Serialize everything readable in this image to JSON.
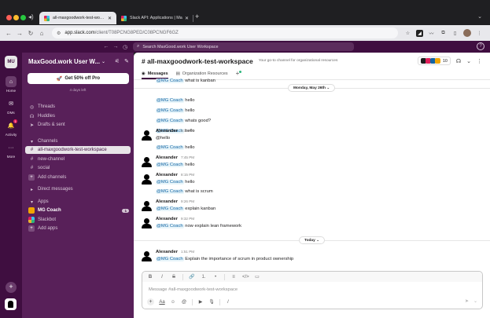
{
  "browser": {
    "tabs": [
      {
        "label": "all-maxgoodwork-test-works",
        "active": true
      },
      {
        "label": "Slack API: Applications | Ma",
        "active": false
      }
    ],
    "url_host": "app.slack.com",
    "url_path": "/client/T08PCNG8PED/C08PCNGF6GZ",
    "new_tab": "+"
  },
  "slack_top": {
    "search_placeholder": "Search MaxGood.work User Workspace",
    "help": "?"
  },
  "rail": {
    "workspace_initials": "MU",
    "items": [
      {
        "label": "Home",
        "icon": "home-icon",
        "glyph": "⌂"
      },
      {
        "label": "DMs",
        "icon": "dm-icon",
        "glyph": "✉"
      },
      {
        "label": "Activity",
        "icon": "bell-icon",
        "glyph": "🔔",
        "badge": "1"
      },
      {
        "label": "More",
        "icon": "more-icon",
        "glyph": "···"
      }
    ],
    "add": "+"
  },
  "sidebar": {
    "workspace_name": "MaxGood.work User W...",
    "promo_label": "Get 50% off Pro",
    "promo_sub": "4 days left",
    "nav": [
      {
        "label": "Threads",
        "icon": "threads-icon",
        "glyph": "◎"
      },
      {
        "label": "Huddles",
        "icon": "headphones-icon",
        "glyph": "☊"
      },
      {
        "label": "Drafts & sent",
        "icon": "send-icon",
        "glyph": "➤"
      }
    ],
    "channels_header": "Channels",
    "channels": [
      {
        "label": "all-maxgoodwork-test-workspace",
        "selected": true
      },
      {
        "label": "new-channel",
        "selected": false
      },
      {
        "label": "social",
        "selected": false
      }
    ],
    "add_channels": "Add channels",
    "dm_header": "Direct messages",
    "apps_header": "Apps",
    "apps": [
      {
        "label": "MG Coach",
        "badge": "1"
      },
      {
        "label": "Slackbot",
        "badge": ""
      }
    ],
    "add_apps": "Add apps"
  },
  "channel": {
    "title": "# all-maxgoodwork-test-workspace",
    "topic": "Your go-to channel for organizational resources",
    "member_count": "10",
    "tabs": [
      {
        "label": "Messages",
        "active": true
      },
      {
        "label": "Organization Resources",
        "active": false
      }
    ]
  },
  "messages": {
    "mention": "@MG Coach",
    "date_old": "Monday, May 26th",
    "date_today": "Today",
    "top_partial": "what is kanban",
    "items": [
      {
        "text": "hello"
      },
      {
        "text": "hello"
      },
      {
        "text": "whats good?"
      },
      {
        "text": "hello"
      },
      {
        "author": "Alexander",
        "time": "5:13 PM",
        "text": "@hello",
        "plain": true
      },
      {
        "text": "hello"
      },
      {
        "author": "Alexander",
        "time": "7:45 PM",
        "text": "hello"
      },
      {
        "author": "Alexander",
        "time": "8:15 PM",
        "text": "hello"
      },
      {
        "text": "what is scrum"
      },
      {
        "author": "Alexander",
        "time": "9:26 PM",
        "text": "explain kanban"
      },
      {
        "author": "Alexander",
        "time": "9:32 PM",
        "text": "now explain lean framework"
      },
      {
        "author": "Alexander",
        "time": "1:51 PM",
        "text": "Explain the importance of scrum in product ownership"
      }
    ]
  },
  "composer": {
    "placeholder": "Message #all-maxgoodwork-test-workspace",
    "format_tools": [
      "B",
      "I",
      "S",
      "🔗",
      "1.",
      "•",
      "≡",
      "</>",
      "▭"
    ],
    "bottom_tools": [
      "+",
      "Aa",
      "☺",
      "@",
      "▶",
      "🎙",
      "/"
    ]
  },
  "colors": {
    "aubergine": "#3f0e40",
    "sidebar": "#582059",
    "mention_bg": "#e8f5fa",
    "mention_text": "#1264a3"
  }
}
